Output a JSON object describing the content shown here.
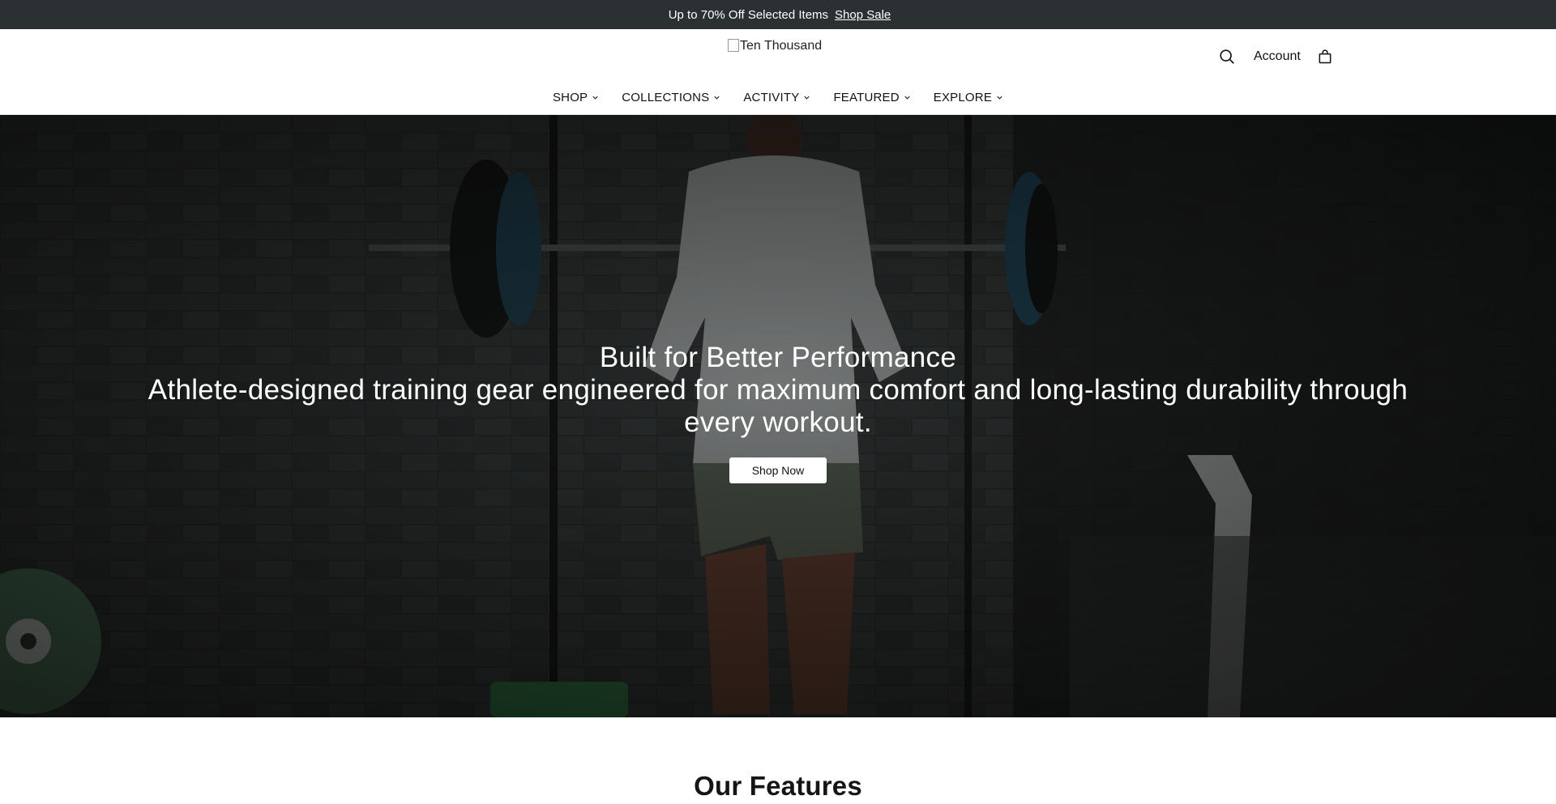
{
  "announcement": {
    "glyph": "",
    "text": "Up to 70% Off Selected Items",
    "link": "Shop Sale",
    "close": ""
  },
  "header": {
    "logo_alt": "Ten Thousand",
    "account_label": "Account",
    "icons": [
      "search-icon",
      "bag-icon"
    ]
  },
  "nav": [
    {
      "label": "SHOP"
    },
    {
      "label": "COLLECTIONS"
    },
    {
      "label": "ACTIVITY"
    },
    {
      "label": "FEATURED"
    },
    {
      "label": "EXPLORE"
    }
  ],
  "hero": {
    "title": "Built for Better Performance",
    "subtitle": "Athlete-designed training gear engineered for maximum comfort and long-lasting durability through every workout.",
    "cta": "Shop Now"
  },
  "features": {
    "title": "Our Features"
  },
  "colors": {
    "announcement_bg": "#2b3033",
    "hero_overlay": "#1d1f1f",
    "button_bg": "#ffffff"
  }
}
